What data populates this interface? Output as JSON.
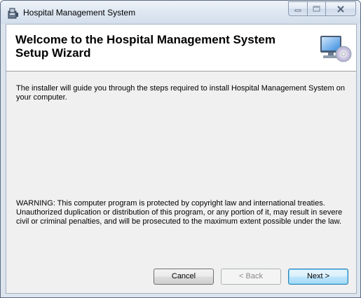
{
  "window": {
    "title": "Hospital Management System"
  },
  "banner": {
    "title_line1": "Welcome to the Hospital Management System",
    "title_line2": "Setup Wizard",
    "icon": "computer-cd-icon"
  },
  "body": {
    "intro": "The installer will guide you through the steps required to install Hospital Management System on your computer.",
    "warning": "WARNING: This computer program is protected by copyright law and international treaties. Unauthorized duplication or distribution of this program, or any portion of it, may result in severe civil or criminal penalties, and will be prosecuted to the maximum extent possible under the law."
  },
  "buttons": {
    "cancel": "Cancel",
    "back": "< Back",
    "next": "Next >"
  },
  "caption_buttons": [
    "minimize-icon",
    "maximize-icon",
    "close-icon"
  ],
  "colors": {
    "client_bg": "#f0f0f0",
    "banner_bg": "#ffffff",
    "default_button_border": "#3c7fb1"
  }
}
